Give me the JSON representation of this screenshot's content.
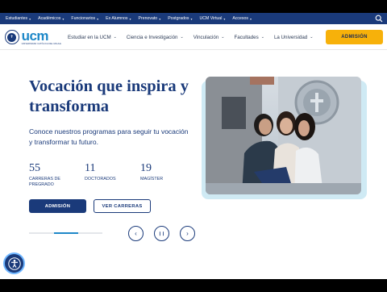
{
  "topbar": {
    "links": [
      "Estudiantes",
      "Académicos",
      "Funcionarios",
      "Ex Alumnos",
      "Prenovato",
      "Postgrados",
      "UCM Virtual",
      "Accesos"
    ]
  },
  "header": {
    "logo_text": "ucm",
    "logo_subtitle": "UNIVERSIDAD CATÓLICA DEL MAULE",
    "nav": [
      "Estudiar en la UCM",
      "Ciencia e Investigación",
      "Vinculación",
      "Facultades",
      "La Universidad"
    ],
    "cta_label": "ADMISIÓN"
  },
  "hero": {
    "title": "Vocación que inspira y transforma",
    "lead": "Conoce nuestros programas para seguir tu vocación y transformar tu futuro.",
    "stats": [
      {
        "num": "55",
        "label": "CARRERAS DE PREGRADO"
      },
      {
        "num": "11",
        "label": "DOCTORADOS"
      },
      {
        "num": "19",
        "label": "MAGÍSTER"
      }
    ],
    "primary_button": "ADMISIÓN",
    "secondary_button": "VER CARRERAS"
  },
  "carousel": {
    "progress": 0.33,
    "prev_symbol": "‹",
    "pause_symbol": "❙❙",
    "next_symbol": "›"
  },
  "colors": {
    "navy": "#1a3a7a",
    "brand_blue": "#1e88c8",
    "accent_yellow": "#f7b10a",
    "photo_frame": "#cfeaf4"
  },
  "icons": [
    "search-icon",
    "chevron-down-icon",
    "accessibility-icon",
    "pause-icon",
    "arrow-left-icon",
    "arrow-right-icon"
  ]
}
